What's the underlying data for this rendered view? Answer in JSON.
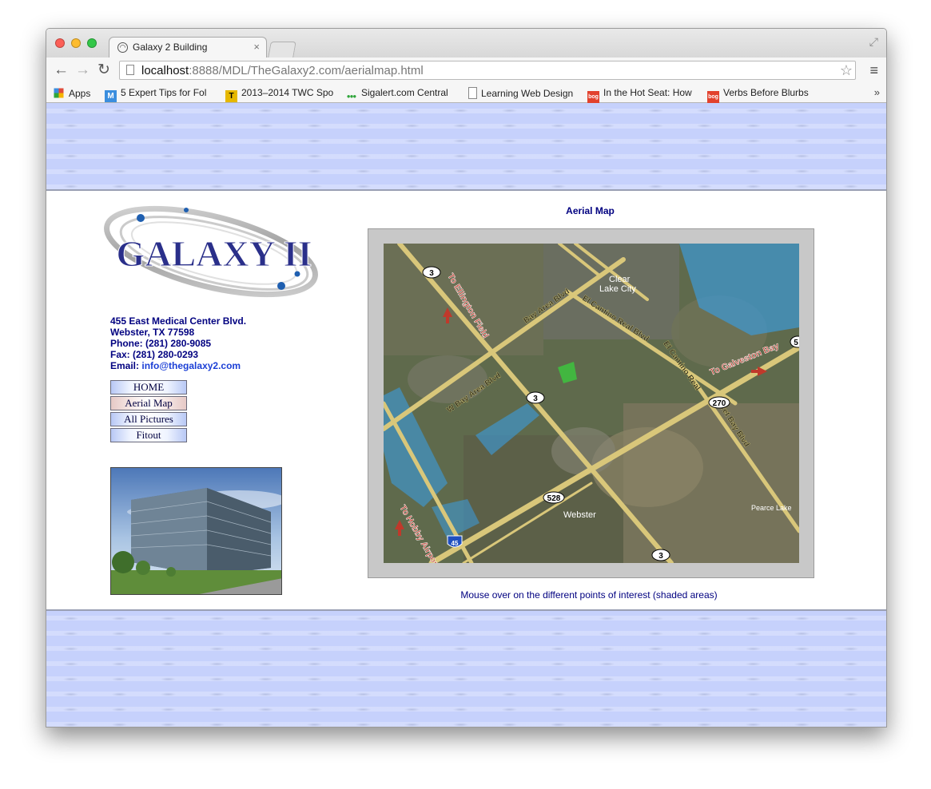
{
  "browser": {
    "tab_title": "Galaxy 2 Building",
    "tab_close": "×",
    "url_host": "localhost",
    "url_rest": ":8888/MDL/TheGalaxy2.com/aerialmap.html",
    "bookmarks": [
      {
        "label": "Apps",
        "icon": "apps-grid-icon",
        "color": "#e04b3a"
      },
      {
        "label": "5 Expert Tips for Fol",
        "icon": "m-icon",
        "color": "#3b8ede"
      },
      {
        "label": "2013–2014 TWC Spo",
        "icon": "twc-icon",
        "color": "#e6b800"
      },
      {
        "label": "Sigalert.com Central",
        "icon": "traffic-light-icon",
        "color": "#2fa53a"
      },
      {
        "label": "Learning Web Design",
        "icon": "page-icon",
        "color": "#ffffff"
      },
      {
        "label": "In the Hot Seat: How",
        "icon": "bog-icon",
        "color": "#e2412d"
      },
      {
        "label": "Verbs Before Blurbs",
        "icon": "bog-icon",
        "color": "#e2412d"
      }
    ],
    "bookmarks_more": "»"
  },
  "site": {
    "logo_text": "GALAXY II",
    "address": {
      "street": "455 East Medical Center Blvd.",
      "city": "Webster, TX 77598",
      "phone": "Phone: (281) 280-9085",
      "fax": "Fax: (281) 280-0293",
      "email_label": "Email: ",
      "email": "info@thegalaxy2.com"
    },
    "nav": [
      {
        "label": "HOME",
        "active": false
      },
      {
        "label": "Aerial Map",
        "active": true
      },
      {
        "label": "All Pictures",
        "active": false
      },
      {
        "label": "Fitout",
        "active": false
      }
    ],
    "map_title": "Aerial Map",
    "map_caption": "Mouse over on the different points of interest (shaded areas)",
    "map_labels": {
      "to_ellington": "To Ellington Field",
      "bay_area": "Bay Area Blvd",
      "w_bay_area": "W Bay Area Blvd",
      "clear_lake_1": "Clear",
      "clear_lake_2": "Lake City",
      "el_camino_1": "El Camino Real Blvd",
      "el_camino_2": "El Camino Real",
      "to_galveston": "To Galveston Bay",
      "egret_bay": "Egret Bay Blvd",
      "to_hobby": "To Hobby Airport",
      "webster": "Webster",
      "pearce_lake": "Pearce Lake",
      "shield_3": "3",
      "shield_270": "270",
      "shield_528": "528",
      "shield_45": "45",
      "shield_5": "5"
    }
  }
}
